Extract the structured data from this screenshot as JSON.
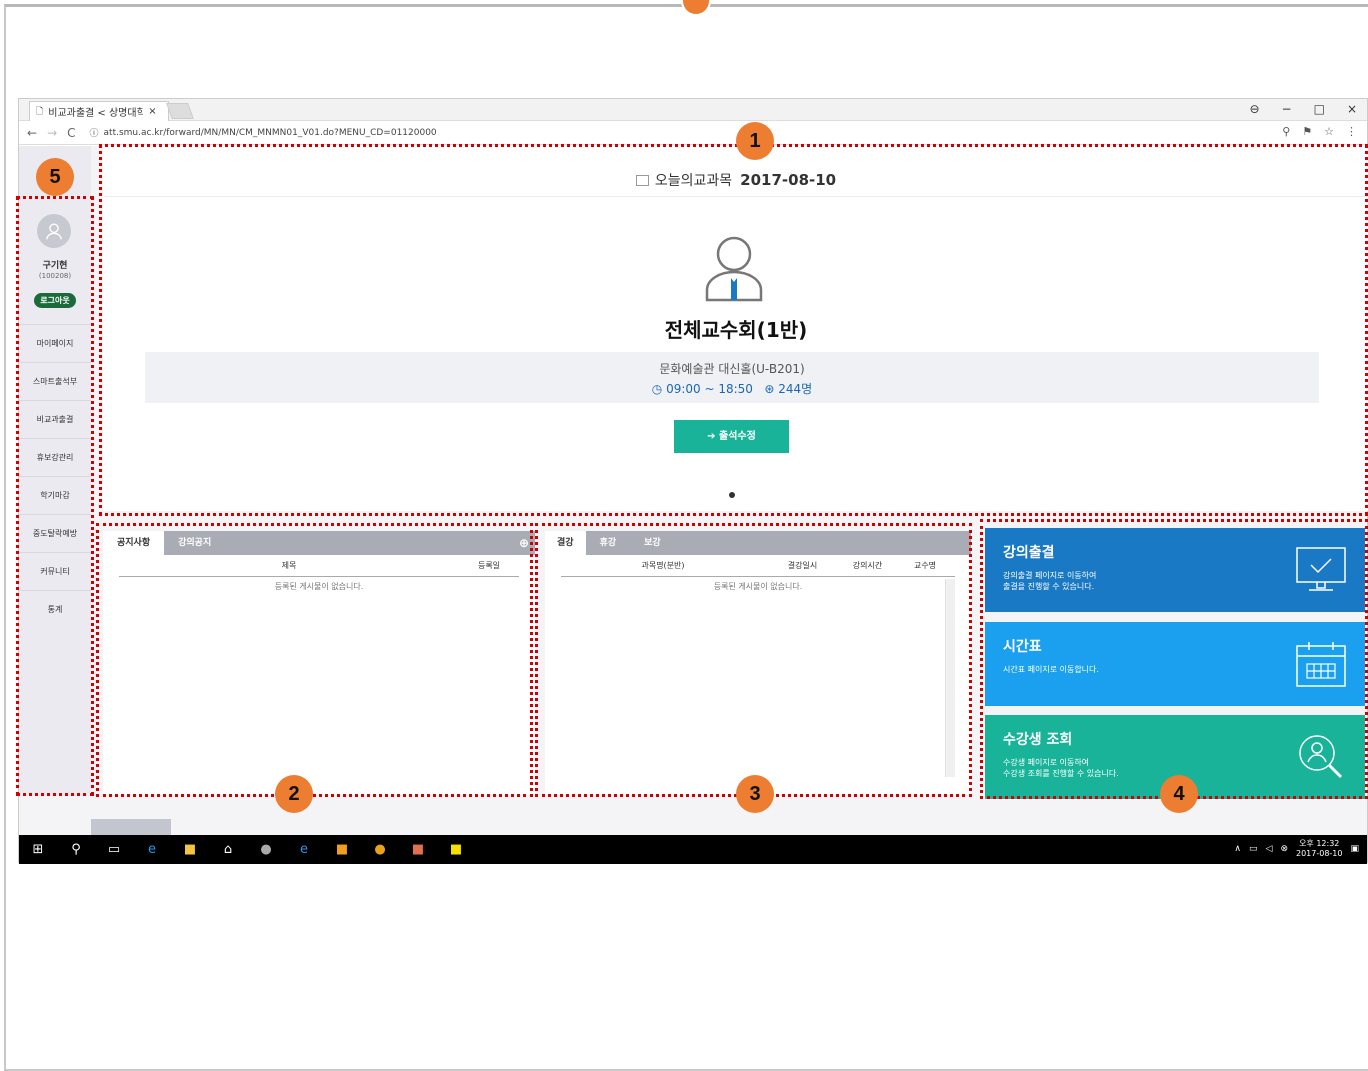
{
  "browser": {
    "tab_title": "비교과출결 < 상명대학교",
    "tab_close": "×",
    "url": "att.smu.ac.kr/forward/MN/MN/CM_MNMN01_V01.do?MENU_CD=01120000",
    "controls": [
      "−",
      "□",
      "×"
    ]
  },
  "header": {
    "label": "오늘의교과목",
    "date": "2017-08-10"
  },
  "lecture": {
    "title": "전체교수회(1반)",
    "room": "문화예술관 대신홀(U-B201)",
    "time": "09:00 ~ 18:50",
    "count": "244명",
    "button": "출석수정"
  },
  "sidebar": {
    "user_name": "구기현",
    "user_id": "(100208)",
    "logout": "로그아웃",
    "items": [
      "마이페이지",
      "스마트출석부",
      "비교과출결",
      "휴보강관리",
      "학기마감",
      "중도탈락예방",
      "커뮤니티",
      "통계"
    ]
  },
  "notice": {
    "tabs": [
      "공지사항",
      "강의공지"
    ],
    "plus": "⊕",
    "columns": [
      "제목",
      "등록일"
    ],
    "empty": "등록된 게시물이 없습니다."
  },
  "absence": {
    "tabs": [
      "결강",
      "휴강",
      "보강"
    ],
    "columns": [
      "과목명(분반)",
      "결강일시",
      "강의시간",
      "교수명"
    ],
    "empty": "등록된 게시물이 없습니다."
  },
  "tiles": [
    {
      "title": "강의출결",
      "desc1": "강의출결 페이지로 이동하여",
      "desc2": "출결을 진행할 수 있습니다."
    },
    {
      "title": "시간표",
      "desc1": "시간표 페이지로 이동합니다.",
      "desc2": ""
    },
    {
      "title": "수강생 조회",
      "desc1": "수강생 페이지로 이동하여",
      "desc2": "수강생 조회를 진행할 수 있습니다."
    }
  ],
  "taskbar": {
    "clock_time": "오후 12:32",
    "clock_date": "2017-08-10"
  },
  "annotations": [
    "1",
    "2",
    "3",
    "4",
    "5"
  ],
  "colors": {
    "accent_orange": "#ed7d31",
    "teal": "#19b39a",
    "blue": "#1a79c4",
    "light_blue": "#1aa0ee",
    "red_dotted": "#d00000"
  }
}
